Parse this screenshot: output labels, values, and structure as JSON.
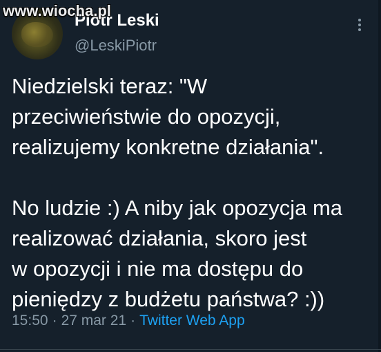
{
  "tweet": {
    "author": {
      "display_name": "Piotr Leski",
      "handle": "@LeskiPiotr"
    },
    "text_paragraphs": [
      "Niedzielski teraz: \"W\nprzeciwieństwie do opozycji,\nrealizujemy konkretne działania\".",
      "No ludzie :) A niby jak opozycja ma\nrealizować działania, skoro jest\nw opozycji i nie ma dostępu do\npieniędzy z budżetu państwa? :))"
    ],
    "time": "15:50",
    "date": "27 mar 21",
    "separator": "·",
    "source": "Twitter Web App"
  },
  "watermark": "www.wiocha.pl",
  "icons": {
    "more": "more-vertical-icon"
  },
  "colors": {
    "background": "#15202b",
    "text": "#ffffff",
    "secondary_text": "#8899a6",
    "link": "#1da1f2"
  }
}
